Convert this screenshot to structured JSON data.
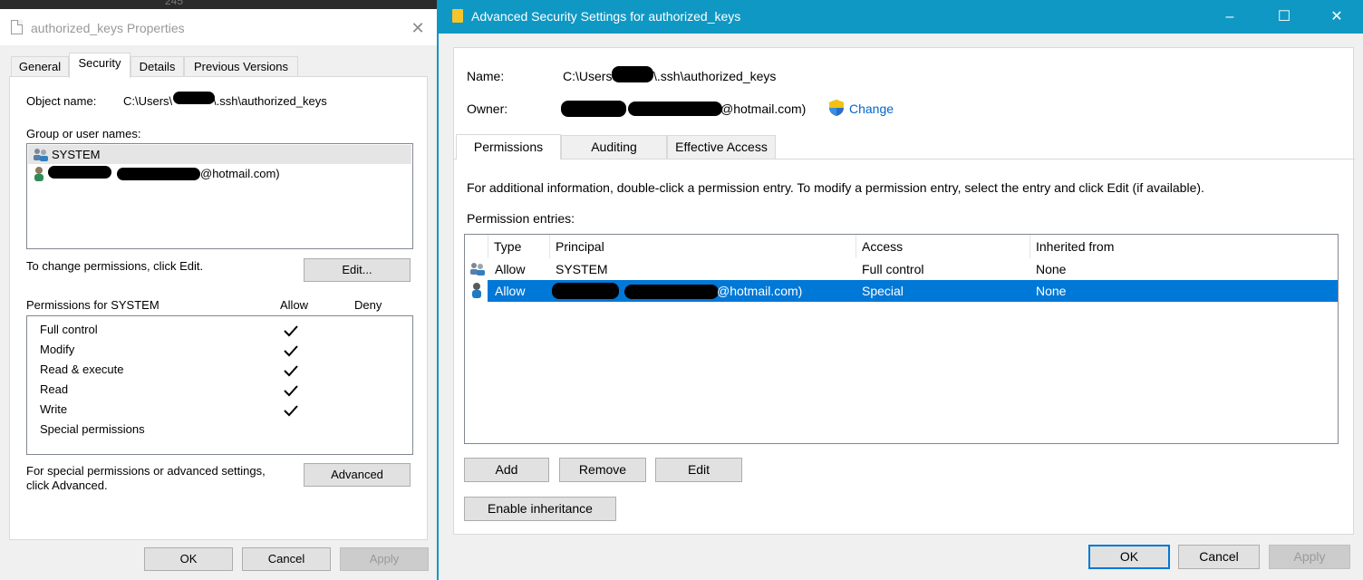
{
  "left_dialog": {
    "title": "authorized_keys Properties",
    "tabs": [
      {
        "label": "General"
      },
      {
        "label": "Security"
      },
      {
        "label": "Details"
      },
      {
        "label": "Previous Versions"
      }
    ],
    "object_name_label": "Object name:",
    "object_name_prefix": "C:\\Users\\",
    "object_name_suffix": "\\.ssh\\authorized_keys",
    "group_label": "Group or user names:",
    "users": [
      {
        "name": "SYSTEM",
        "icon": "users-group-icon"
      },
      {
        "name_suffix": "@hotmail.com)",
        "icon": "user-icon"
      }
    ],
    "change_hint": "To change permissions, click Edit.",
    "edit_button": "Edit...",
    "perms_for_label": "Permissions for SYSTEM",
    "allow_label": "Allow",
    "deny_label": "Deny",
    "permissions": [
      {
        "name": "Full control",
        "allow": true
      },
      {
        "name": "Modify",
        "allow": true
      },
      {
        "name": "Read & execute",
        "allow": true
      },
      {
        "name": "Read",
        "allow": true
      },
      {
        "name": "Write",
        "allow": true
      },
      {
        "name": "Special permissions",
        "allow": false
      }
    ],
    "advanced_hint_1": "For special permissions or advanced settings,",
    "advanced_hint_2": "click Advanced.",
    "advanced_button": "Advanced",
    "ok_button": "OK",
    "cancel_button": "Cancel",
    "apply_button": "Apply",
    "background_number": "245"
  },
  "right_dialog": {
    "title": "Advanced Security Settings for authorized_keys",
    "name_label": "Name:",
    "name_prefix": "C:\\Users\\",
    "name_suffix": "\\.ssh\\authorized_keys",
    "owner_label": "Owner:",
    "owner_suffix": "@hotmail.com)",
    "change_link": "Change",
    "tabs": [
      {
        "label": "Permissions"
      },
      {
        "label": "Auditing"
      },
      {
        "label": "Effective Access"
      }
    ],
    "info_text": "For additional information, double-click a permission entry. To modify a permission entry, select the entry and click Edit (if available).",
    "entries_label": "Permission entries:",
    "columns": [
      "Type",
      "Principal",
      "Access",
      "Inherited from"
    ],
    "entries": [
      {
        "type": "Allow",
        "principal": "SYSTEM",
        "access": "Full control",
        "inherited": "None",
        "icon": "users-group-icon"
      },
      {
        "type": "Allow",
        "principal": "@hotmail.com)",
        "access": "Special",
        "inherited": "None",
        "icon": "user-icon"
      }
    ],
    "add_button": "Add",
    "remove_button": "Remove",
    "edit_button": "Edit",
    "enable_inheritance_button": "Enable inheritance",
    "ok_button": "OK",
    "cancel_button": "Cancel",
    "apply_button": "Apply"
  },
  "colors": {
    "titlebar": "#0f98c4",
    "selection": "#0078d7",
    "link": "#0066cc"
  }
}
